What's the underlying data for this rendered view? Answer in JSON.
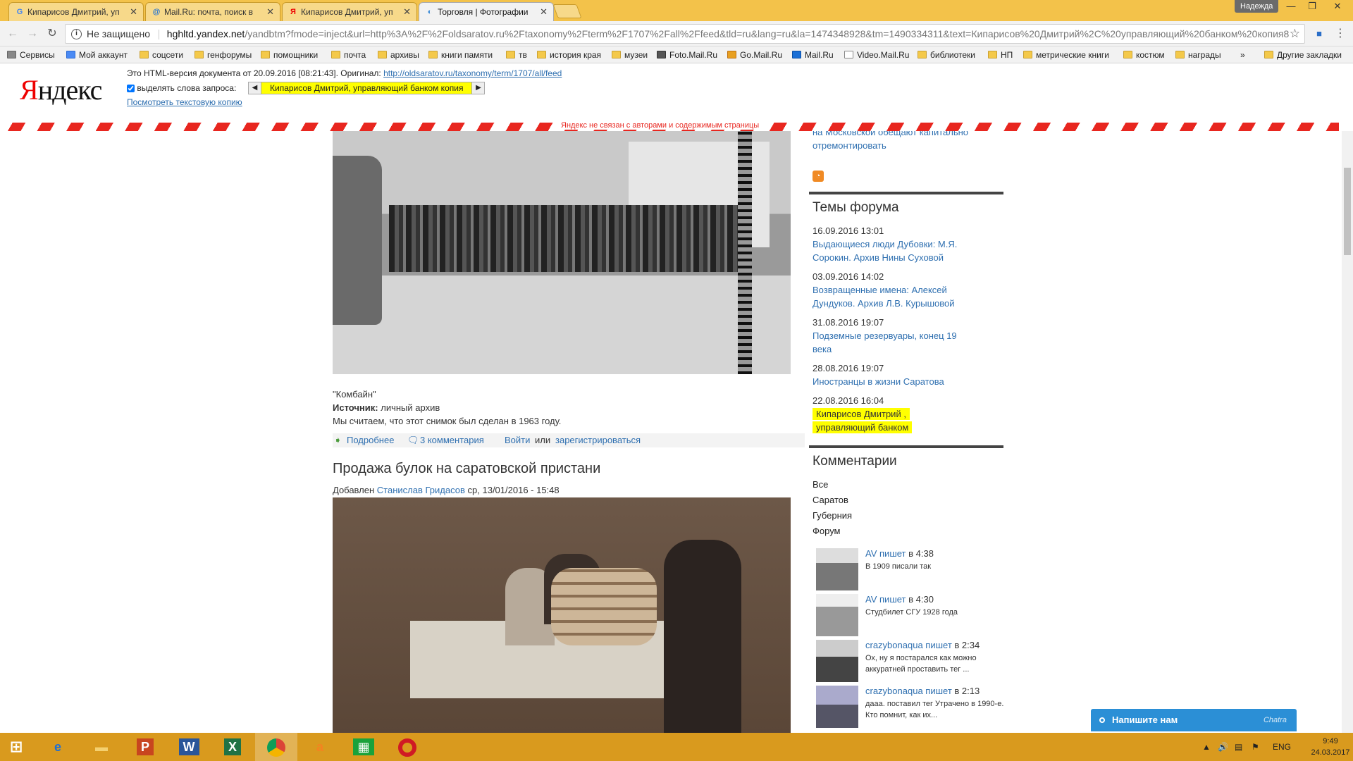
{
  "tabs": [
    {
      "label": "Кипарисов Дмитрий, уп",
      "icon": "G"
    },
    {
      "label": "Mail.Ru: почта, поиск в",
      "icon": "@"
    },
    {
      "label": "Кипарисов Дмитрий, уп",
      "icon": "Я"
    },
    {
      "label": "Торговля | Фотографии",
      "icon": "◐"
    }
  ],
  "window": {
    "profile": "Надежда",
    "minimize": "—",
    "maximize": "❐",
    "close": "✕"
  },
  "toolbar": {
    "security": "Не защищено",
    "url_host": "hghltd.yandex.net",
    "url_rest": "/yandbtm?fmode=inject&url=http%3A%2F%2Foldsaratov.ru%2Ftaxonomy%2Fterm%2F1707%2Fall%2Ffeed&tld=ru&lang=ru&la=1474348928&tm=1490334311&text=Кипарисов%20Дмитрий%2C%20управляющий%20банком%20копия8"
  },
  "bookmarks": [
    "Сервисы",
    "Мой аккаунт",
    "соцсети",
    "генфорумы",
    "помощники",
    "почта",
    "архивы",
    "книги памяти",
    "тв",
    "история края",
    "музеи",
    "Foto.Mail.Ru",
    "Go.Mail.Ru",
    "Mail.Ru",
    "Video.Mail.Ru",
    "библиотеки",
    "НП",
    "метрические книги",
    "костюм",
    "награды",
    "»",
    "Другие закладки"
  ],
  "yandex": {
    "logo_a": "Я",
    "logo_b": "ндекс",
    "cache_note": "Это HTML-версия документа от 20.09.2016 [08:21:43]. Оригинал:",
    "original_url": "http://oldsaratov.ru/taxonomy/term/1707/all/feed",
    "highlight_label": "выделять слова запроса:",
    "query": "Кипарисов Дмитрий, управляющий банком копия",
    "text_copy": "Посмотреть текстовую копию",
    "disclaimer": "Яндекс не связан с авторами и содержимым страницы"
  },
  "post1": {
    "caption": "\"Комбайн\"",
    "source_label": "Источник:",
    "source_value": " личный архив",
    "body": "Мы считаем, что этот снимок был сделан в 1963 году.",
    "more": "Подробнее",
    "comments": "3 комментария",
    "login": "Войти",
    "or": "или",
    "register": "зарегистрироваться"
  },
  "post2": {
    "title": "Продажа булок на саратовской пристани",
    "added": "Добавлен",
    "author": "Станислав Гридасов",
    "date": "ср, 13/01/2016 - 15:48"
  },
  "sidebar": {
    "top_link_a": "на Московской обещают капитально",
    "top_link_b": "отремонтировать",
    "forum_title": "Темы форума",
    "forum": [
      {
        "date": "16.09.2016 13:01",
        "a": "Выдающиеся люди Дубовки: М.Я.",
        "b": "Сорокин. Архив Нины Суховой"
      },
      {
        "date": "03.09.2016 14:02",
        "a": "Возвращенные имена: Алексей",
        "b": "Дундуков. Архив Л.В. Курышовой"
      },
      {
        "date": "31.08.2016 19:07",
        "a": "Подземные резервуары, конец 19",
        "b": "века"
      },
      {
        "date": "28.08.2016 19:07",
        "a": "Иностранцы в жизни Саратова",
        "b": ""
      },
      {
        "date": "22.08.2016 16:04",
        "a": "Кипарисов Дмитрий ,",
        "b": "управляющий банком"
      }
    ],
    "comments_title": "Комментарии",
    "filters": [
      "Все",
      "Саратов",
      "Губерния",
      "Форум"
    ],
    "comments": [
      {
        "user": "AV",
        "writes": "пишет",
        "at": "в 4:38",
        "text": "В 1909 писали так"
      },
      {
        "user": "AV",
        "writes": "пишет",
        "at": "в 4:30",
        "text": "Студбилет СГУ 1928 года"
      },
      {
        "user": "crazybonaqua",
        "writes": "пишет",
        "at": "в 2:34",
        "text": "Ох, ну я постарался как можно аккуратней проставить тег ..."
      },
      {
        "user": "crazybonaqua",
        "writes": "пишет",
        "at": "в 2:13",
        "text": "дааа. поставил тег Утрачено в 1990-е. Кто помнит, как их..."
      }
    ]
  },
  "chat": {
    "label": "Напишите нам",
    "brand": "Chatra"
  },
  "taskbar": {
    "lang": "ENG",
    "time": "9:49",
    "date": "24.03.2017"
  }
}
